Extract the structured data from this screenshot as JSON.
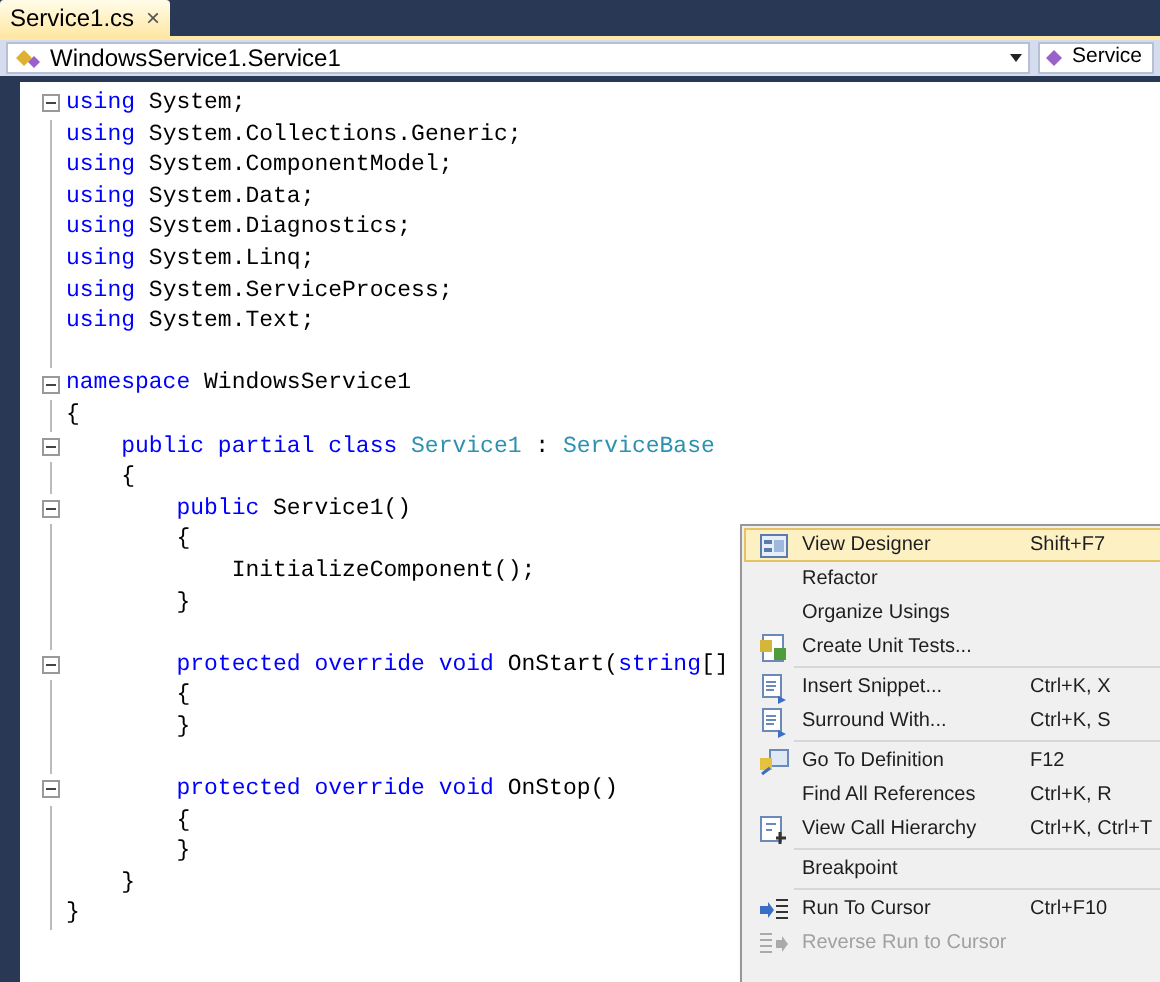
{
  "tab": {
    "title": "Service1.cs",
    "close": "×"
  },
  "nav": {
    "type_combo": "WindowsService1.Service1",
    "member_combo": "Service"
  },
  "code": [
    {
      "fold": true,
      "tokens": [
        {
          "kind": "keyword",
          "text": "using"
        },
        {
          "kind": "plain",
          "text": " System;"
        }
      ]
    },
    {
      "fold": false,
      "tokens": [
        {
          "kind": "keyword",
          "text": "using"
        },
        {
          "kind": "plain",
          "text": " System.Collections.Generic;"
        }
      ]
    },
    {
      "fold": false,
      "tokens": [
        {
          "kind": "keyword",
          "text": "using"
        },
        {
          "kind": "plain",
          "text": " System.ComponentModel;"
        }
      ]
    },
    {
      "fold": false,
      "tokens": [
        {
          "kind": "keyword",
          "text": "using"
        },
        {
          "kind": "plain",
          "text": " System.Data;"
        }
      ]
    },
    {
      "fold": false,
      "tokens": [
        {
          "kind": "keyword",
          "text": "using"
        },
        {
          "kind": "plain",
          "text": " System.Diagnostics;"
        }
      ]
    },
    {
      "fold": false,
      "tokens": [
        {
          "kind": "keyword",
          "text": "using"
        },
        {
          "kind": "plain",
          "text": " System.Linq;"
        }
      ]
    },
    {
      "fold": false,
      "tokens": [
        {
          "kind": "keyword",
          "text": "using"
        },
        {
          "kind": "plain",
          "text": " System.ServiceProcess;"
        }
      ]
    },
    {
      "fold": false,
      "tokens": [
        {
          "kind": "keyword",
          "text": "using"
        },
        {
          "kind": "plain",
          "text": " System.Text;"
        }
      ]
    },
    {
      "fold": false
    },
    {
      "fold": true,
      "tokens": [
        {
          "kind": "keyword",
          "text": "namespace"
        },
        {
          "kind": "plain",
          "text": " WindowsService1"
        }
      ]
    },
    {
      "fold": false,
      "tokens": [
        {
          "kind": "plain",
          "text": "{"
        }
      ]
    },
    {
      "fold": true,
      "tokens": [
        {
          "kind": "keyword",
          "text": "    public partial class "
        },
        {
          "kind": "type",
          "text": "Service1"
        },
        {
          "kind": "plain",
          "text": " : "
        },
        {
          "kind": "type",
          "text": "ServiceBase"
        }
      ]
    },
    {
      "fold": false,
      "tokens": [
        {
          "kind": "plain",
          "text": "    {"
        }
      ]
    },
    {
      "fold": true,
      "tokens": [
        {
          "kind": "keyword",
          "text": "        public"
        },
        {
          "kind": "plain",
          "text": " Service1()"
        }
      ]
    },
    {
      "fold": false,
      "tokens": [
        {
          "kind": "plain",
          "text": "        {"
        }
      ]
    },
    {
      "fold": false,
      "tokens": [
        {
          "kind": "plain",
          "text": "            InitializeComponent();"
        }
      ]
    },
    {
      "fold": false,
      "tokens": [
        {
          "kind": "plain",
          "text": "        }"
        }
      ]
    },
    {
      "fold": false
    },
    {
      "fold": true,
      "tokens": [
        {
          "kind": "keyword",
          "text": "        protected override void"
        },
        {
          "kind": "plain",
          "text": " OnStart("
        },
        {
          "kind": "keyword",
          "text": "string"
        },
        {
          "kind": "plain",
          "text": "[]"
        }
      ]
    },
    {
      "fold": false,
      "tokens": [
        {
          "kind": "plain",
          "text": "        {"
        }
      ]
    },
    {
      "fold": false,
      "tokens": [
        {
          "kind": "plain",
          "text": "        }"
        }
      ]
    },
    {
      "fold": false
    },
    {
      "fold": true,
      "tokens": [
        {
          "kind": "keyword",
          "text": "        protected override void"
        },
        {
          "kind": "plain",
          "text": " OnStop()"
        }
      ]
    },
    {
      "fold": false,
      "tokens": [
        {
          "kind": "plain",
          "text": "        {"
        }
      ]
    },
    {
      "fold": false,
      "tokens": [
        {
          "kind": "plain",
          "text": "        }"
        }
      ]
    },
    {
      "fold": false,
      "tokens": [
        {
          "kind": "plain",
          "text": "    }"
        }
      ]
    },
    {
      "fold": false,
      "tokens": [
        {
          "kind": "plain",
          "text": "}"
        }
      ]
    }
  ],
  "menu": [
    {
      "kind": "designer",
      "label": "View Designer",
      "shortcut": "Shift+F7",
      "selected": true,
      "disabled": false,
      "separator_before": false
    },
    {
      "kind": "plain",
      "label": "Refactor",
      "selected": false,
      "disabled": false,
      "separator_before": false
    },
    {
      "kind": "plain",
      "label": "Organize Usings",
      "selected": false,
      "disabled": false,
      "separator_before": false
    },
    {
      "kind": "tests",
      "label": "Create Unit Tests...",
      "selected": false,
      "disabled": false,
      "separator_before": false
    },
    {
      "kind": "snippet",
      "label": "Insert Snippet...",
      "shortcut": "Ctrl+K, X",
      "selected": false,
      "disabled": false,
      "separator_before": true
    },
    {
      "kind": "snippet",
      "label": "Surround With...",
      "shortcut": "Ctrl+K, S",
      "selected": false,
      "disabled": false,
      "separator_before": false
    },
    {
      "kind": "goto",
      "label": "Go To Definition",
      "shortcut": "F12",
      "selected": false,
      "disabled": false,
      "separator_before": true
    },
    {
      "kind": "plain",
      "label": "Find All References",
      "shortcut": "Ctrl+K, R",
      "selected": false,
      "disabled": false,
      "separator_before": false
    },
    {
      "kind": "hierarchy",
      "label": "View Call Hierarchy",
      "shortcut": "Ctrl+K, Ctrl+T",
      "selected": false,
      "disabled": false,
      "separator_before": false
    },
    {
      "kind": "plain",
      "label": "Breakpoint",
      "selected": false,
      "disabled": false,
      "separator_before": true
    },
    {
      "kind": "run",
      "label": "Run To Cursor",
      "shortcut": "Ctrl+F10",
      "selected": false,
      "disabled": false,
      "separator_before": true
    },
    {
      "kind": "reverse",
      "label": "Reverse Run to Cursor",
      "selected": false,
      "disabled": true,
      "separator_before": false
    }
  ]
}
